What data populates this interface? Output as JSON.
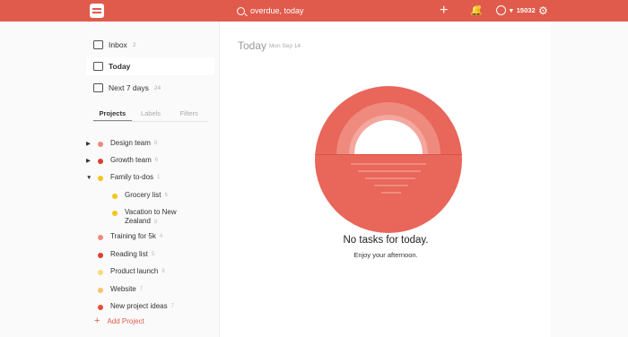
{
  "topbar": {
    "search_text": "overdue, today",
    "karma_value": "15032",
    "icons": [
      "logo-icon",
      "search-icon",
      "plus-icon",
      "bell-icon",
      "karma-icon",
      "gear-icon"
    ]
  },
  "nav": {
    "inbox": {
      "label": "Inbox",
      "count": "2"
    },
    "today": {
      "label": "Today"
    },
    "next7": {
      "label": "Next 7 days",
      "count": "24"
    }
  },
  "tabs": [
    "Projects",
    "Labels",
    "Filters"
  ],
  "projects": [
    {
      "label": "Design team",
      "count": "8",
      "color": "#f08a7c",
      "expand": "▶",
      "icon": "person"
    },
    {
      "label": "Growth team",
      "count": "6",
      "color": "#d6402f",
      "expand": "▶"
    },
    {
      "label": "Family to-dos",
      "count": "1",
      "color": "#f5c518",
      "expand": "▼"
    },
    {
      "label": "Grocery list",
      "count": "6",
      "color": "#f5c518",
      "child": true
    },
    {
      "label": "Vacation to New",
      "label2": "Zealand",
      "count": "8",
      "color": "#f5c518",
      "child": true
    },
    {
      "label": "Training for 5k",
      "count": "4",
      "color": "#f08a7c"
    },
    {
      "label": "Reading list",
      "count": "5",
      "color": "#d6402f"
    },
    {
      "label": "Product launch",
      "count": "8",
      "color": "#f7dd72"
    },
    {
      "label": "Website",
      "count": "7",
      "color": "#f7c46a"
    },
    {
      "label": "New project ideas",
      "count": "7",
      "color": "#e4502e"
    }
  ],
  "add_project": "Add Project",
  "main": {
    "title": "Today",
    "date": "Mon Sep 14",
    "empty_title": "No tasks for today.",
    "empty_sub": "Enjoy your afternoon."
  },
  "colors": {
    "brand": "#e05b4c",
    "sun": "#e8665a"
  }
}
